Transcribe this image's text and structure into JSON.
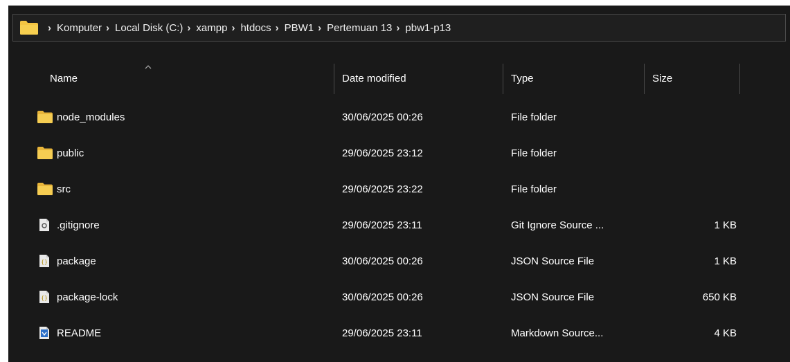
{
  "colors": {
    "background": "#191919",
    "text": "#ffffff",
    "folder": "#f4c542",
    "divider": "#4a4a4a"
  },
  "address_bar": {
    "icon": "folder-icon",
    "crumbs": [
      "Komputer",
      "Local Disk (C:)",
      "xampp",
      "htdocs",
      "PBW1",
      "Pertemuan 13",
      "pbw1-p13"
    ]
  },
  "columns": {
    "name": "Name",
    "date_modified": "Date modified",
    "type": "Type",
    "size": "Size",
    "sort_icon": "sort-ascending-icon"
  },
  "files": [
    {
      "name": "node_modules",
      "date": "30/06/2025 00:26",
      "type": "File folder",
      "size": "",
      "icon": "folder-icon"
    },
    {
      "name": "public",
      "date": "29/06/2025 23:12",
      "type": "File folder",
      "size": "",
      "icon": "folder-icon"
    },
    {
      "name": "src",
      "date": "29/06/2025 23:22",
      "type": "File folder",
      "size": "",
      "icon": "folder-icon"
    },
    {
      "name": ".gitignore",
      "date": "29/06/2025 23:11",
      "type": "Git Ignore Source ...",
      "size": "1 KB",
      "icon": "gitignore-file-icon"
    },
    {
      "name": "package",
      "date": "30/06/2025 00:26",
      "type": "JSON Source File",
      "size": "1 KB",
      "icon": "json-file-icon"
    },
    {
      "name": "package-lock",
      "date": "30/06/2025 00:26",
      "type": "JSON Source File",
      "size": "650 KB",
      "icon": "json-file-icon"
    },
    {
      "name": "README",
      "date": "29/06/2025 23:11",
      "type": "Markdown Source...",
      "size": "4 KB",
      "icon": "markdown-file-icon"
    }
  ]
}
